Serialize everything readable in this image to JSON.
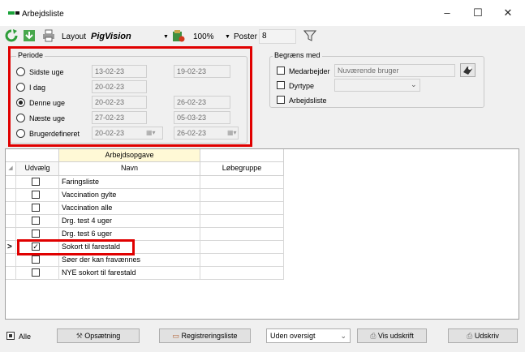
{
  "window": {
    "title": "Arbejdsliste",
    "controls": {
      "minimize": "–",
      "maximize": "☐",
      "close": "✕"
    }
  },
  "toolbar": {
    "layout_label": "Layout",
    "layout_value": "PigVision",
    "zoom_value": "100%",
    "poster_label": "Poster",
    "poster_value": "8",
    "icons": [
      "refresh-icon",
      "download-icon",
      "print-icon",
      "layout-settings-icon",
      "filter-icon"
    ]
  },
  "periode": {
    "legend": "Periode",
    "options": [
      {
        "label": "Sidste uge",
        "from": "13-02-23",
        "to": "19-02-23",
        "selected": false
      },
      {
        "label": "I dag",
        "from": "20-02-23",
        "to": "",
        "selected": false
      },
      {
        "label": "Denne uge",
        "from": "20-02-23",
        "to": "26-02-23",
        "selected": true
      },
      {
        "label": "Næste uge",
        "from": "27-02-23",
        "to": "05-03-23",
        "selected": false
      },
      {
        "label": "Brugerdefineret",
        "from": "20-02-23",
        "to": "26-02-23",
        "selected": false
      }
    ]
  },
  "begraens": {
    "legend": "Begræns med",
    "medarbejder_label": "Medarbejder",
    "medarbejder_placeholder": "Nuværende bruger",
    "dyrtype_label": "Dyrtype",
    "arbejdsliste_label": "Arbejdsliste"
  },
  "grid": {
    "group_header": "Arbejdsopgave",
    "columns": {
      "udvaelg": "Udvælg",
      "navn": "Navn",
      "loebegruppe": "Løbegruppe"
    },
    "rows": [
      {
        "navn": "Faringsliste",
        "checked": false
      },
      {
        "navn": "Vaccination gylte",
        "checked": false
      },
      {
        "navn": "Vaccination alle",
        "checked": false
      },
      {
        "navn": "Drg. test 4 uger",
        "checked": false
      },
      {
        "navn": "Drg. test 6 uger",
        "checked": false
      },
      {
        "navn": "Sokort til farestald",
        "checked": true,
        "current": true
      },
      {
        "navn": "Søer der kan fravænnes",
        "checked": false
      },
      {
        "navn": "NYE sokort til farestald",
        "checked": false
      }
    ],
    "current_marker": ">"
  },
  "bottom": {
    "alle_label": "Alle",
    "opsaetning_label": "Opsætning",
    "registreringsliste_label": "Registreringsliste",
    "oversigt_value": "Uden oversigt",
    "vis_udskrift_label": "Vis udskrift",
    "udskriv_label": "Udskriv"
  },
  "colors": {
    "highlight_box": "#e00000",
    "group_header_bg": "#fff9d6",
    "panel_bg": "#f0f0f0"
  }
}
